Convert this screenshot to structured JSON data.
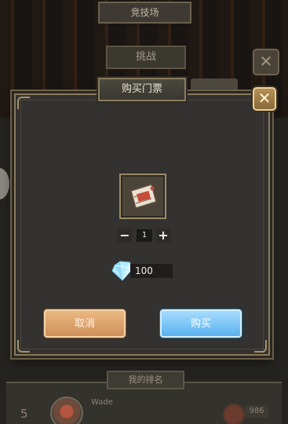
{
  "background": {
    "screen_title": "竞技场",
    "subtitle": "挑战",
    "close_icon": "close-icon",
    "ranking_label": "我的排名",
    "my_rank": "5",
    "player_name": "Wade",
    "score": "986"
  },
  "dialog": {
    "title": "购买门票",
    "close_icon": "close-icon",
    "item_icon": "ticket-icon",
    "quantity": "1",
    "minus_label": "−",
    "plus_label": "+",
    "currency_icon": "diamond-icon",
    "price": "100",
    "cancel_label": "取消",
    "buy_label": "购买"
  },
  "colors": {
    "cancel_button": "#dca06a",
    "buy_button": "#7cc6f6",
    "frame": "#8a7a5a"
  }
}
